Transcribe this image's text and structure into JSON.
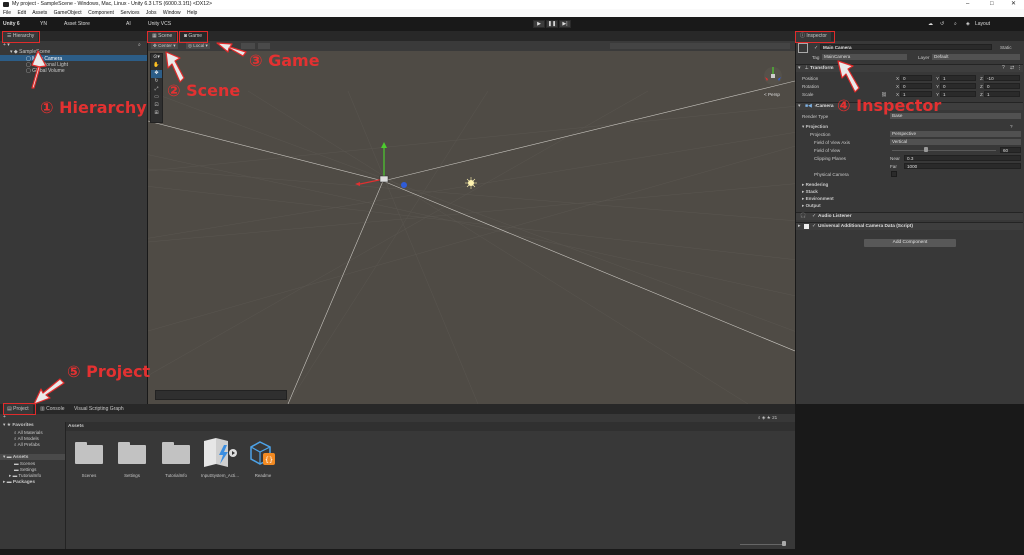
{
  "window": {
    "title": "My project - SampleScene - Windows, Mac, Linux - Unity 6.3 LTS (6000.3.1f1) <DX12>",
    "controls": [
      "–",
      "□",
      "✕"
    ]
  },
  "menu": [
    "File",
    "Edit",
    "Assets",
    "GameObject",
    "Component",
    "Services",
    "Jobs",
    "Window",
    "Help"
  ],
  "toolbar": {
    "brand": "Unity 6",
    "account": "YN",
    "asset_store": "Asset Store",
    "ai": "AI",
    "vcs": "Unity VCS",
    "layout": "Layout",
    "play": "▶",
    "pause": "❚❚",
    "step": "▶|"
  },
  "hierarchy": {
    "tab": "Hierarchy",
    "scene": "SampleScene",
    "items": [
      "Main Camera",
      "Directional Light",
      "Global Volume"
    ]
  },
  "scene": {
    "tab_scene": "Scene",
    "tab_game": "Game",
    "pivot": "Center",
    "space": "Local",
    "persp": "< Persp"
  },
  "inspector": {
    "tab": "Inspector",
    "object_name": "Main Camera",
    "static": "Static",
    "tag_label": "Tag",
    "tag_value": "MainCamera",
    "layer_label": "Layer",
    "layer_value": "Default",
    "transform": {
      "title": "Transform",
      "position_label": "Position",
      "rotation_label": "Rotation",
      "scale_label": "Scale",
      "axis_x": "X",
      "axis_y": "Y",
      "axis_z": "Z",
      "position": [
        "0",
        "1",
        "-10"
      ],
      "rotation": [
        "0",
        "0",
        "0"
      ],
      "scale": [
        "1",
        "1",
        "1"
      ]
    },
    "camera": {
      "title": "Camera",
      "render_type_label": "Render Type",
      "render_type_value": "Base",
      "projection_section": "Projection",
      "projection_label": "Projection",
      "projection_value": "Perspective",
      "fov_axis_label": "Field of View Axis",
      "fov_axis_value": "Vertical",
      "fov_label": "Field of View",
      "fov_value": "60",
      "fov_fraction": 0.33,
      "clipping_label": "Clipping Planes",
      "near_label": "Near",
      "near_value": "0.3",
      "far_label": "Far",
      "far_value": "1000",
      "physical_label": "Physical Camera",
      "sections": [
        "Rendering",
        "Stack",
        "Environment",
        "Output"
      ]
    },
    "audio_listener": "Audio Listener",
    "urp_data": "Universal Additional Camera Data (Script)",
    "add_component": "Add Component"
  },
  "project": {
    "tab_project": "Project",
    "tab_console": "Console",
    "tab_vsg": "Visual Scripting Graph",
    "favorites": "Favorites",
    "fav_items": [
      "All Materials",
      "All Models",
      "All Prefabs"
    ],
    "assets": "Assets",
    "asset_items": [
      "Scenes",
      "Settings",
      "TutorialInfo"
    ],
    "packages": "Packages",
    "breadcrumb": "Assets",
    "grid_items": [
      "Scenes",
      "Settings",
      "TutorialInfo",
      "InputSystem_Acti...",
      "Readme"
    ],
    "count": "21"
  },
  "annotations": {
    "hierarchy": "① Hierarchy",
    "scene": "② Scene",
    "game": "③ Game",
    "inspector": "④ Inspector",
    "project": "⑤ Project"
  },
  "colors": {
    "annotation": "#e33131",
    "panel": "#383838",
    "scene_bg": "#4f4b45",
    "selection": "#2c5d87",
    "axis_x": "#e03030",
    "axis_y": "#4ccc2e",
    "axis_z": "#2f5cd8"
  }
}
